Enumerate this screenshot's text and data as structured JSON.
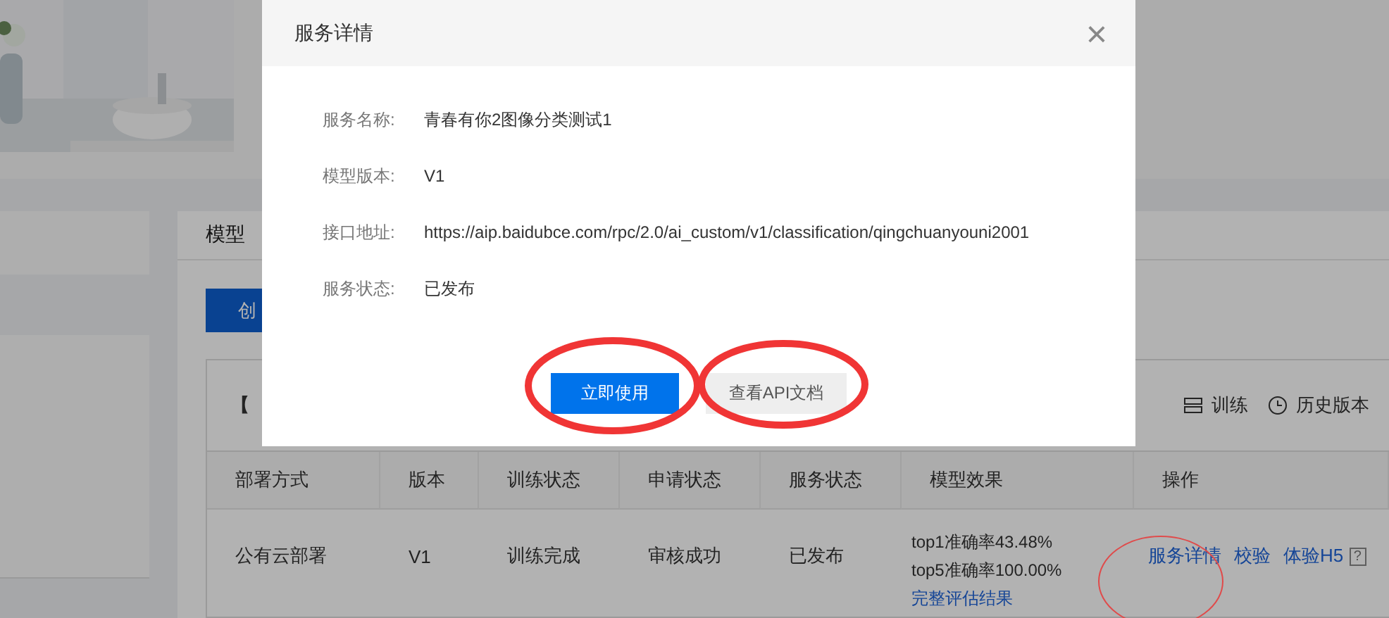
{
  "background": {
    "card_title": "模型",
    "create_button": "创",
    "model_title": "【",
    "toolbar": [
      {
        "kind": "train",
        "label": "训练"
      },
      {
        "kind": "history",
        "label": "历史版本"
      }
    ],
    "table": {
      "columns": [
        "部署方式",
        "版本",
        "训练状态",
        "申请状态",
        "服务状态",
        "模型效果",
        "操作"
      ],
      "rows": [
        {
          "cells": [
            "公有云部署",
            "V1",
            "训练完成",
            "审核成功",
            "已发布"
          ],
          "effect": [
            "top1准确率43.48%",
            "top5准确率100.00%"
          ],
          "effect_link": "完整评估结果",
          "actions": [
            "服务详情",
            "校验",
            "体验H5"
          ],
          "help": "?"
        }
      ]
    }
  },
  "modal": {
    "title": "服务详情",
    "close": "×",
    "fields": [
      {
        "label": "服务名称:",
        "value": "青春有你2图像分类测试1"
      },
      {
        "label": "模型版本:",
        "value": "V1"
      },
      {
        "label": "接口地址:",
        "value": "https://aip.baidubce.com/rpc/2.0/ai_custom/v1/classification/qingchuanyouni2001"
      },
      {
        "label": "服务状态:",
        "value": "已发布"
      }
    ],
    "buttons": [
      {
        "kind": "primary",
        "label": "立即使用"
      },
      {
        "kind": "secondary",
        "label": "查看API文档"
      }
    ]
  }
}
